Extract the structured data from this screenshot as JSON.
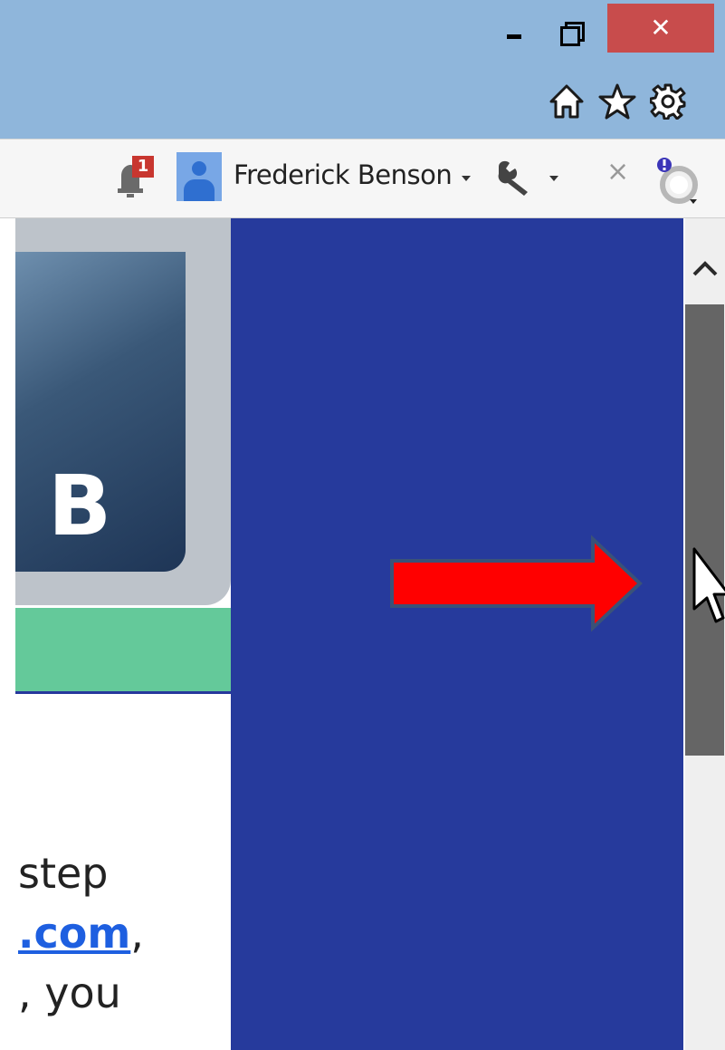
{
  "window": {
    "minimize_icon": "minimize-icon",
    "restore_icon": "restore-icon",
    "close_label": "✕",
    "close_color": "#c84c4c",
    "titlebar_color": "#8fb6db"
  },
  "nav": {
    "icons": [
      "home-icon",
      "star-icon",
      "gear-icon"
    ]
  },
  "toolbar": {
    "notification_count": "1",
    "user_name": "Frederick Benson",
    "close_label": "×"
  },
  "main": {
    "logo_letter": "B",
    "text_lines": [
      {
        "text": "step"
      },
      {
        "link": ".com",
        "after": ","
      },
      {
        "text": ", you"
      }
    ],
    "colors": {
      "panel": "#263a9c",
      "band": "#64c99a",
      "arrow": "#ff0000",
      "link": "#1e5fe0"
    }
  }
}
